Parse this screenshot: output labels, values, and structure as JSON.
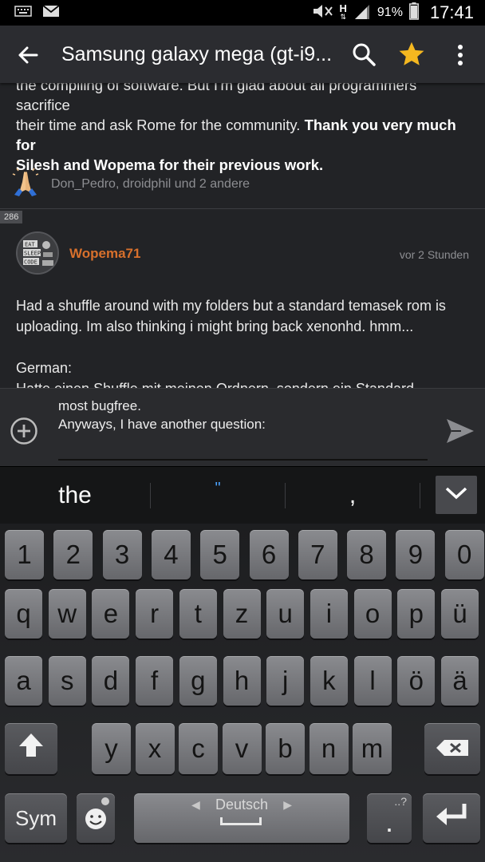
{
  "status_bar": {
    "battery": "91%",
    "time": "17:41",
    "network": "H",
    "icons": [
      "keyboard-icon",
      "mail-icon",
      "mute-icon",
      "network-h-icon",
      "signal-icon",
      "battery-icon"
    ]
  },
  "app_bar": {
    "title": "Samsung galaxy mega (gt-i9...",
    "icons": [
      "back-arrow-icon",
      "search-icon",
      "star-icon",
      "more-vert-icon"
    ],
    "star_color": "#f5b820"
  },
  "previous_post": {
    "line1": "the compiling of software. But I'm glad about all programmers sacrifice",
    "line2_plain": "their time and ask Rome for the community. ",
    "line2_bold": "Thank you very much for",
    "line3_bold": "Silesh and Wopema for their previous work.",
    "likes_text": "Don_Pedro, droidphil und 2 andere",
    "likes_icon": "praying-hands-icon"
  },
  "post": {
    "number": "286",
    "avatar_lines": [
      "EAT",
      "SLEEP",
      "CODE"
    ],
    "username": "Wopema71",
    "username_color": "#d8702c",
    "time": "vor 2 Stunden",
    "body_p1": "Had a shuffle around with my folders but a standard temasek rom is uploading. Im also thinking i might bring back xenonhd. hmm...",
    "body_p2_heading": "German:",
    "body_p2_line": "Hatte einen Shuffle mit meinen Ordnern, sondern ein Standard"
  },
  "composer": {
    "line1": "most bugfree.",
    "line2": "Anyways, I have another question:"
  },
  "suggestions": [
    "the",
    "\"",
    ","
  ],
  "keyboard": {
    "numbers": [
      "1",
      "2",
      "3",
      "4",
      "5",
      "6",
      "7",
      "8",
      "9",
      "0"
    ],
    "row1": [
      "q",
      "w",
      "e",
      "r",
      "t",
      "z",
      "u",
      "i",
      "o",
      "p",
      "ü"
    ],
    "row2": [
      "a",
      "s",
      "d",
      "f",
      "g",
      "h",
      "j",
      "k",
      "l",
      "ö",
      "ä"
    ],
    "row3": [
      "y",
      "x",
      "c",
      "v",
      "b",
      "n",
      "m"
    ],
    "sym_label": "Sym",
    "space_label": "Deutsch",
    "period_label": ".",
    "period_hint": "..?"
  }
}
